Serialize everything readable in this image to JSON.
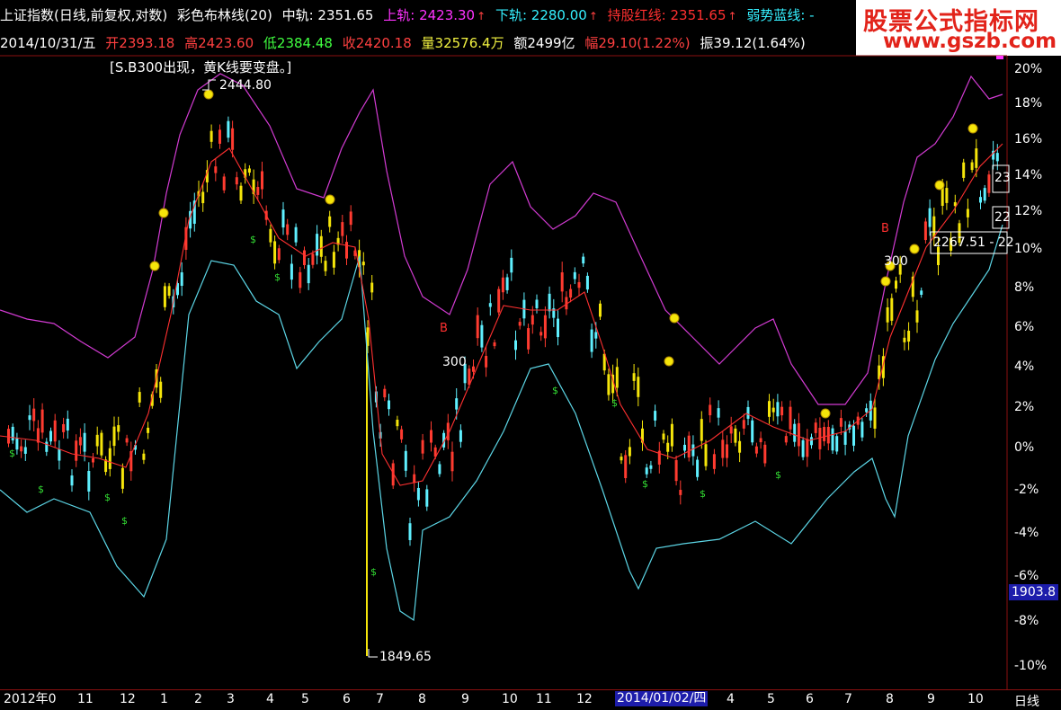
{
  "header": {
    "index_name": "上证指数(日线,前复权,对数)",
    "indicator_name": "彩色布林线(20)",
    "mid_label": "中轨: 2351.65",
    "upper_label": "上轨: 2423.30",
    "lower_label": "下轨: 2280.00",
    "hold_label": "持股红线: 2351.65",
    "weak_label": "弱势蓝线: -",
    "arrow": "↑"
  },
  "quote": {
    "date": "2014/10/31/五",
    "open": "开2393.18",
    "high": "高2423.60",
    "low": "低2384.48",
    "close": "收2420.18",
    "volume": "量32576.4万",
    "amount": "额2499亿",
    "change": "幅29.10(1.22%)",
    "amplitude": "振39.12(1.64%)"
  },
  "watermark": {
    "title": "股票公式指标网",
    "url": "www.gszb.com"
  },
  "message": "[S.B300出现，黄K线要变盘。]",
  "annotations": {
    "high_value": "2444.80",
    "low_value": "1849.65",
    "label_300_a": "300",
    "label_300_b": "300",
    "marker_b_a": "B",
    "marker_b_b": "B",
    "range_label": "2267.51 - 22",
    "price_tag": "1903.8",
    "edge_label_a": "23",
    "edge_label_b": "22"
  },
  "percent_axis": [
    "20%",
    "18%",
    "16%",
    "14%",
    "12%",
    "10%",
    "8%",
    "6%",
    "4%",
    "2%",
    "0%",
    "-2%",
    "-4%",
    "-6%",
    "-8%",
    "-10%"
  ],
  "time_axis": [
    "2012年0",
    "11",
    "12",
    "1",
    "2",
    "3",
    "4",
    "5",
    "6",
    "7",
    "8",
    "9",
    "10",
    "11",
    "12",
    "2014/01/02/四",
    "4",
    "5",
    "6",
    "7",
    "8",
    "9",
    "10"
  ],
  "daily_tab": "日线",
  "colors": {
    "up": "#ff3b30",
    "down": "#5ff0ff",
    "signal": "#f5e50a",
    "upper_band": "#d23bd2",
    "lower_band": "#5cd6e6",
    "mid_band": "#ff3030",
    "background": "#000000",
    "mid_text": "#ffffff",
    "upper_text": "#ff33ff",
    "lower_text": "#35f0ff",
    "hold_text": "#ff3030",
    "weak_text": "#35f0ff",
    "open_text": "#ff4040",
    "high_text": "#ff4040",
    "low_text": "#40ff40",
    "close_text": "#ff4040",
    "volume_text": "#f0f040",
    "change_text": "#ff4040"
  }
}
